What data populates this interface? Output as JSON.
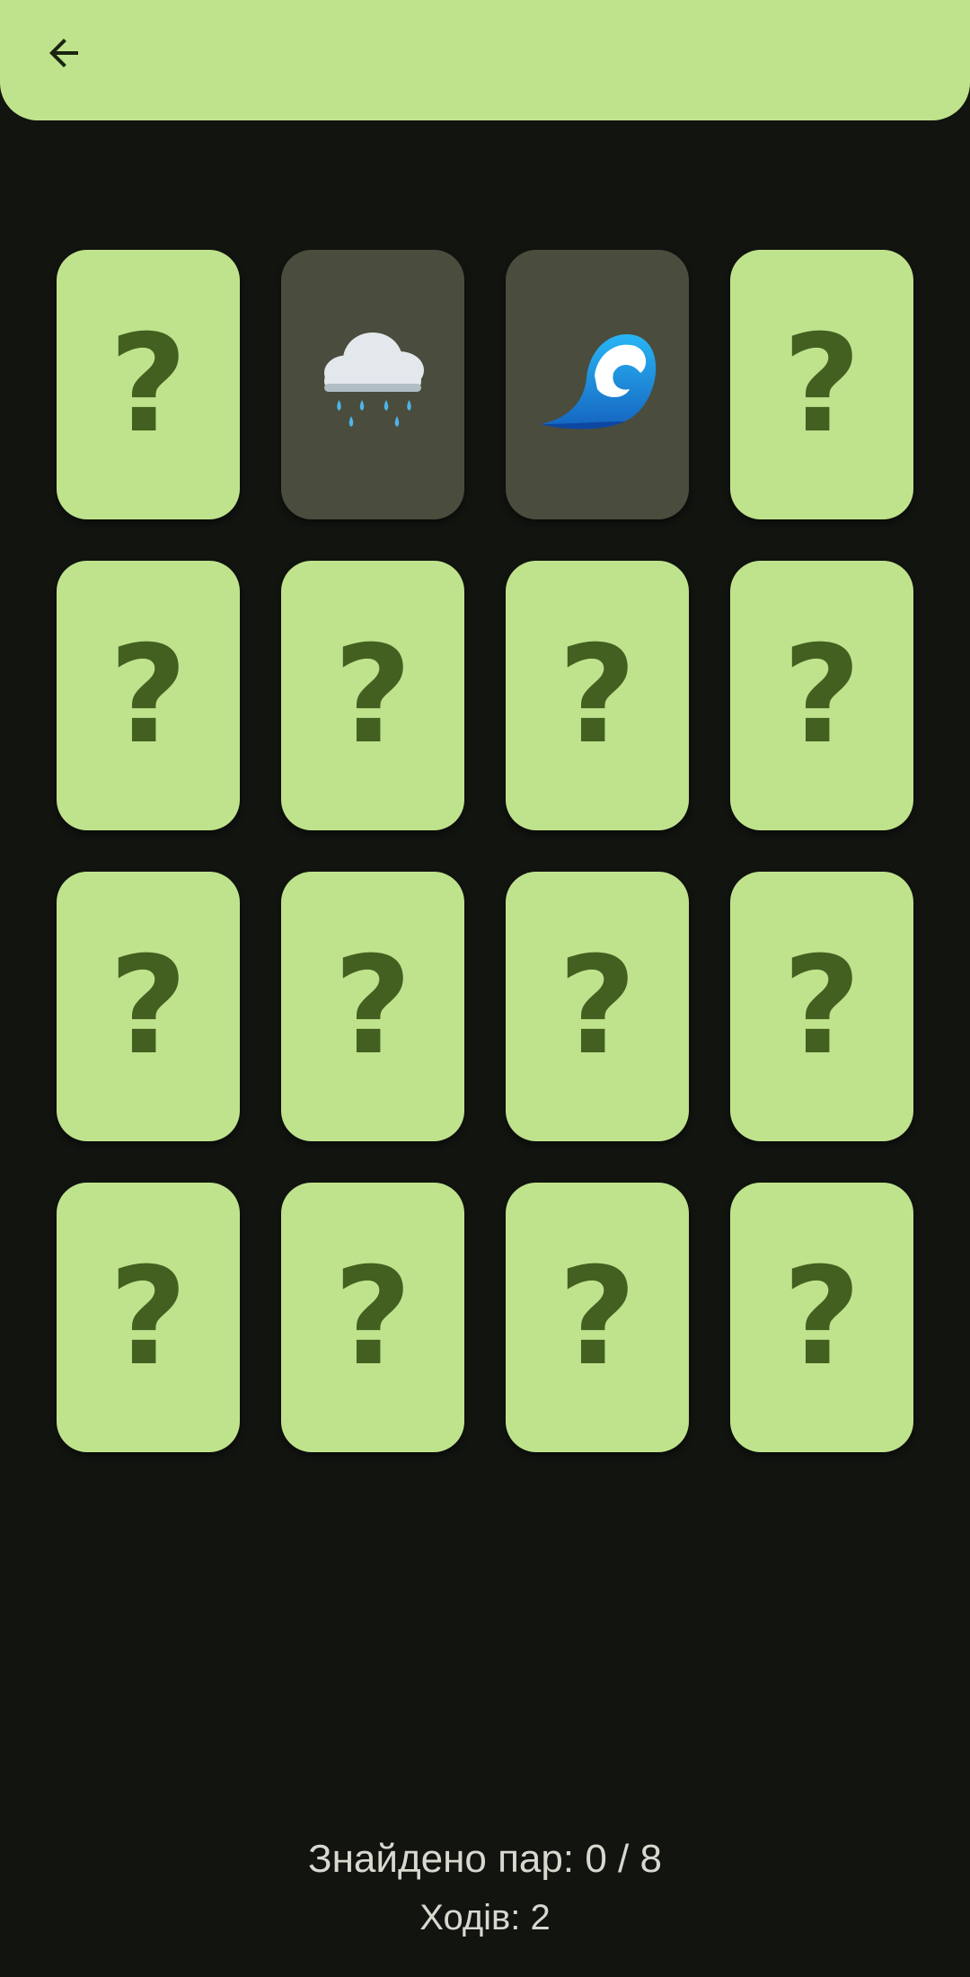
{
  "header": {
    "back_icon": "arrow-left-icon"
  },
  "board": {
    "hidden_symbol": "?",
    "cards": [
      {
        "state": "hidden"
      },
      {
        "state": "revealed",
        "icon": "rain-cloud-icon",
        "emoji": "🌧️"
      },
      {
        "state": "revealed",
        "icon": "water-wave-icon",
        "emoji": "🌊"
      },
      {
        "state": "hidden"
      },
      {
        "state": "hidden"
      },
      {
        "state": "hidden"
      },
      {
        "state": "hidden"
      },
      {
        "state": "hidden"
      },
      {
        "state": "hidden"
      },
      {
        "state": "hidden"
      },
      {
        "state": "hidden"
      },
      {
        "state": "hidden"
      },
      {
        "state": "hidden"
      },
      {
        "state": "hidden"
      },
      {
        "state": "hidden"
      },
      {
        "state": "hidden"
      }
    ]
  },
  "stats": {
    "pairs_found_label": "Знайдено пар: 0 / 8",
    "moves_label": "Ходів: 2"
  },
  "colors": {
    "accent": "#bfe38c",
    "background": "#121410",
    "revealed_card": "#4a4c3d",
    "question_mark": "#436021"
  }
}
